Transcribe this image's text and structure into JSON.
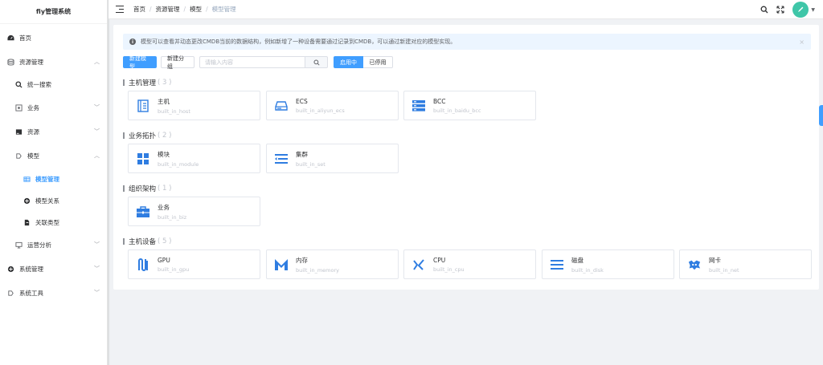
{
  "app": {
    "title": "fiy管理系统"
  },
  "sidebar": {
    "items": [
      {
        "label": "首页",
        "icon": "dashboard-icon"
      },
      {
        "label": "资源管理",
        "icon": "database-icon"
      },
      {
        "label": "统一搜索",
        "icon": "search-icon"
      },
      {
        "label": "业务",
        "icon": "business-icon"
      },
      {
        "label": "资源",
        "icon": "resource-icon"
      },
      {
        "label": "模型",
        "icon": "model-icon"
      },
      {
        "label": "模型管理",
        "icon": "model-manage-icon"
      },
      {
        "label": "模型关系",
        "icon": "relation-icon"
      },
      {
        "label": "关联类型",
        "icon": "link-type-icon"
      },
      {
        "label": "运营分析",
        "icon": "monitor-icon"
      },
      {
        "label": "系统管理",
        "icon": "system-icon"
      },
      {
        "label": "系统工具",
        "icon": "tools-icon"
      }
    ]
  },
  "breadcrumb": {
    "home": "首页",
    "level1": "资源管理",
    "level2": "模型",
    "current": "模型管理"
  },
  "alert": {
    "text": "模型可以查看并动态更改CMDB当前的数据结构，例如新增了一种设备需要通过记录到CMDB，可以通过新建对应的模型实现。",
    "close": "×"
  },
  "toolbar": {
    "new_model": "新建模型",
    "new_group": "新建分组",
    "search_placeholder": "请输入内容",
    "enabled": "启用中",
    "disabled": "已停用"
  },
  "groups": [
    {
      "title": "主机管理",
      "count": "( 3 )",
      "cards": [
        {
          "name": "主机",
          "id": "built_in_host",
          "icon": "host-icon"
        },
        {
          "name": "ECS",
          "id": "built_in_aliyun_ecs",
          "icon": "ecs-icon"
        },
        {
          "name": "BCC",
          "id": "built_in_baidu_bcc",
          "icon": "bcc-icon"
        }
      ]
    },
    {
      "title": "业务拓扑",
      "count": "( 2 )",
      "cards": [
        {
          "name": "模块",
          "id": "built_in_module",
          "icon": "module-icon"
        },
        {
          "name": "集群",
          "id": "built_in_set",
          "icon": "cluster-icon"
        }
      ]
    },
    {
      "title": "组织架构",
      "count": "( 1 )",
      "cards": [
        {
          "name": "业务",
          "id": "built_in_biz",
          "icon": "briefcase-icon"
        }
      ]
    },
    {
      "title": "主机设备",
      "count": "( 5 )",
      "cards": [
        {
          "name": "GPU",
          "id": "built_in_gpu",
          "icon": "gpu-icon"
        },
        {
          "name": "内存",
          "id": "built_in_memory",
          "icon": "memory-icon"
        },
        {
          "name": "CPU",
          "id": "built_in_cpu",
          "icon": "cpu-icon"
        },
        {
          "name": "磁盘",
          "id": "built_in_disk",
          "icon": "disk-icon"
        },
        {
          "name": "网卡",
          "id": "built_in_net",
          "icon": "network-card-icon"
        }
      ]
    }
  ],
  "colors": {
    "primary": "#409eff",
    "icon_blue": "#2f7de1",
    "avatar": "#3fc6a8"
  }
}
